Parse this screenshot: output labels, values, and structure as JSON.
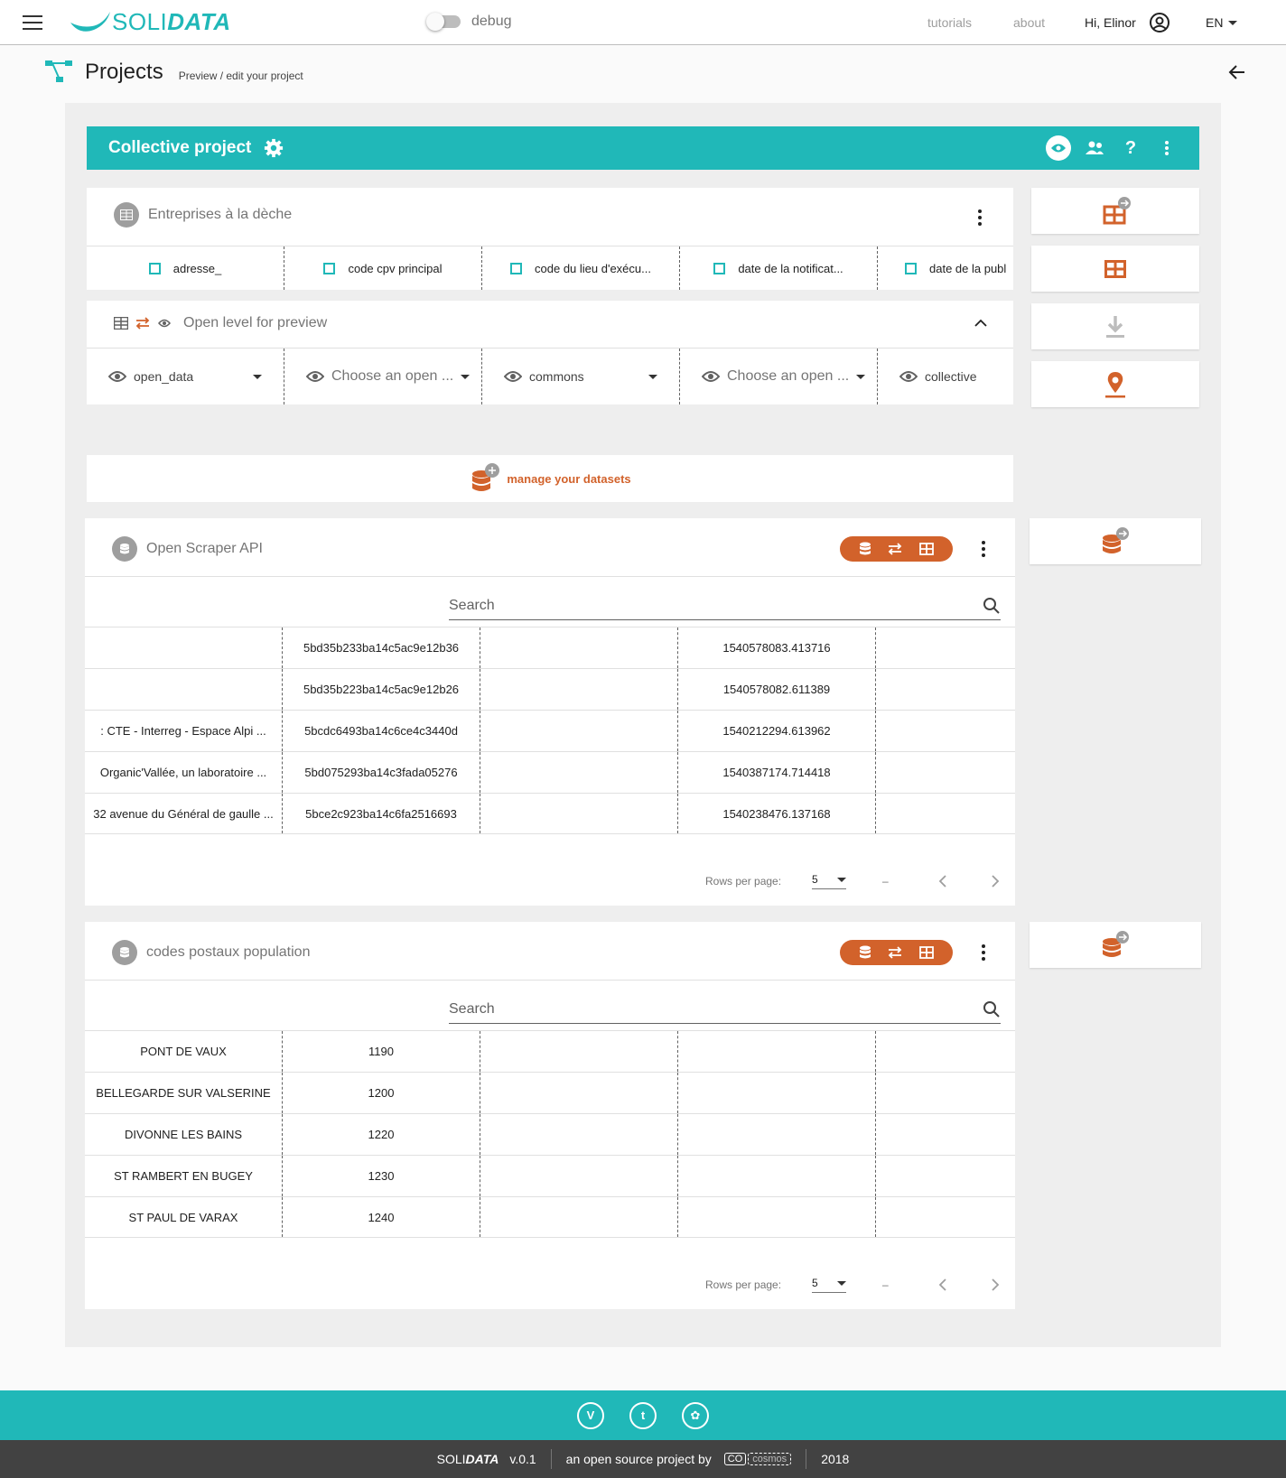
{
  "app": {
    "logo_light": "SOLI",
    "logo_bold": "DATA",
    "debug_label": "debug"
  },
  "nav": {
    "tutorials": "tutorials",
    "about": "about",
    "user": "Hi, Elinor",
    "lang": "EN"
  },
  "page": {
    "title": "Projects",
    "subtitle": "Preview / edit your project"
  },
  "project": {
    "title": "Collective project"
  },
  "entreprises": {
    "title": "Entreprises à la dèche",
    "columns": [
      "adresse_",
      "code cpv principal",
      "code du lieu d'exécu...",
      "date de la notificat...",
      "date de la publ"
    ]
  },
  "open_level": {
    "title": "Open level for preview",
    "selects": [
      {
        "value": "open_data",
        "placeholder": false
      },
      {
        "value": "Choose an open ...",
        "placeholder": true
      },
      {
        "value": "commons",
        "placeholder": false
      },
      {
        "value": "Choose an open ...",
        "placeholder": true
      },
      {
        "value": "collective",
        "placeholder": false
      }
    ]
  },
  "manage": {
    "label": "manage your datasets"
  },
  "dataset1": {
    "title": "Open Scraper API",
    "search_placeholder": "Search",
    "rows": [
      [
        "",
        "5bd35b233ba14c5ac9e12b36",
        "",
        "1540578083.413716",
        ""
      ],
      [
        "",
        "5bd35b223ba14c5ac9e12b26",
        "",
        "1540578082.611389",
        ""
      ],
      [
        ": CTE - Interreg - Espace Alpi ...",
        "5bcdc6493ba14c6ce4c3440d",
        "",
        "1540212294.613962",
        ""
      ],
      [
        "Organic'Vallée, un laboratoire ...",
        "5bd075293ba14c3fada05276",
        "",
        "1540387174.714418",
        ""
      ],
      [
        "32 avenue du Général de gaulle ...",
        "5bce2c923ba14c6fa2516693",
        "",
        "1540238476.137168",
        ""
      ]
    ],
    "rows_per_page_label": "Rows per page:",
    "rows_per_page": "5",
    "range": "–"
  },
  "dataset2": {
    "title": "codes postaux population",
    "search_placeholder": "Search",
    "rows": [
      [
        "PONT DE VAUX",
        "1190",
        "",
        "",
        ""
      ],
      [
        "BELLEGARDE SUR VALSERINE",
        "1200",
        "",
        "",
        ""
      ],
      [
        "DIVONNE LES BAINS",
        "1220",
        "",
        "",
        ""
      ],
      [
        "ST RAMBERT EN BUGEY",
        "1230",
        "",
        "",
        ""
      ],
      [
        "ST PAUL DE VARAX",
        "1240",
        "",
        "",
        ""
      ]
    ],
    "rows_per_page_label": "Rows per page:",
    "rows_per_page": "5",
    "range": "–"
  },
  "footer": {
    "brand_light": "SOLI",
    "brand_bold": "DATA",
    "version": "v.0.1",
    "tagline": "an open source project by",
    "org_logo_text": "CO cosmos",
    "year": "2018"
  },
  "colors": {
    "accent": "#20b8b8",
    "orange": "#d2622b",
    "footer_dark": "#424242"
  },
  "icons": [
    "menu-icon",
    "eye-icon",
    "people-icon",
    "help-icon",
    "more-vert-icon",
    "settings-icon",
    "table-icon",
    "swap-icon",
    "database-icon",
    "download-icon",
    "map-pin-icon",
    "search-icon",
    "arrow-back-icon",
    "account-icon"
  ]
}
